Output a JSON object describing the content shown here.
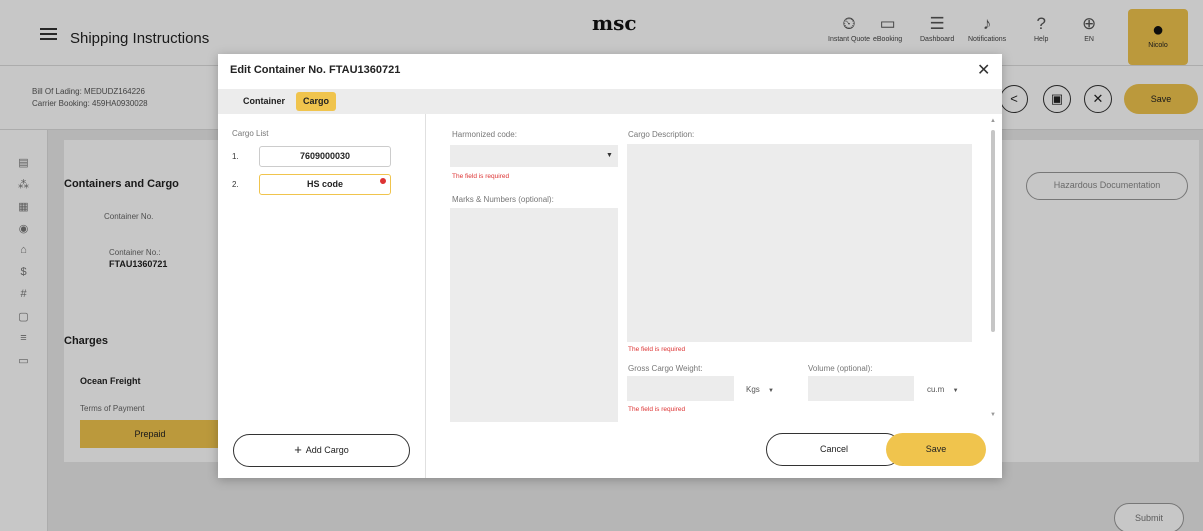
{
  "app": {
    "title": "Shipping Instructions",
    "logo": "msc",
    "top_icons": [
      {
        "icon": "clock-icon",
        "label": "Instant Quote"
      },
      {
        "icon": "cart-icon",
        "label": "eBooking"
      },
      {
        "icon": "dashboard-icon",
        "label": "Dashboard"
      },
      {
        "icon": "bell-icon",
        "label": "Notifications"
      },
      {
        "icon": "help-icon",
        "label": "Help"
      },
      {
        "icon": "globe-icon",
        "label": "EN"
      }
    ],
    "user": "Nicolo",
    "bill_of_lading": "Bill Of Lading: MEDUDZ164226",
    "carrier_booking": "Carrier Booking: 459HA0930028",
    "save_label": "Save",
    "containers_heading": "Containers and Cargo",
    "container_no_col": "Container No.",
    "container_no_label": "Container No.:",
    "container_no_value": "FTAU1360721",
    "hazardous_label": "Hazardous Documentation",
    "charges_heading": "Charges",
    "ocean_freight": "Ocean Freight",
    "terms_of_payment": "Terms of Payment",
    "prepaid": "Prepaid",
    "submit": "Submit"
  },
  "modal": {
    "title": "Edit Container No. FTAU1360721",
    "tabs": [
      "Container",
      "Cargo"
    ],
    "active_tab": "Cargo",
    "cargo_list_label": "Cargo List",
    "cargo_items": [
      {
        "num": "1.",
        "value": "7609000030"
      },
      {
        "num": "2.",
        "value": "HS code"
      }
    ],
    "add_cargo": "Add Cargo",
    "harmonized_code_label": "Harmonized code:",
    "harmonized_code_value": "",
    "harmonized_error": "The field is required",
    "marks_label": "Marks & Numbers (optional):",
    "cargo_description_label": "Cargo Description:",
    "cargo_description_error": "The field is required",
    "gross_weight_label": "Gross Cargo Weight:",
    "gross_weight_unit": "Kgs",
    "gross_weight_error": "The field is required",
    "volume_label": "Volume (optional):",
    "volume_unit": "cu.m",
    "cancel": "Cancel",
    "save": "Save"
  }
}
